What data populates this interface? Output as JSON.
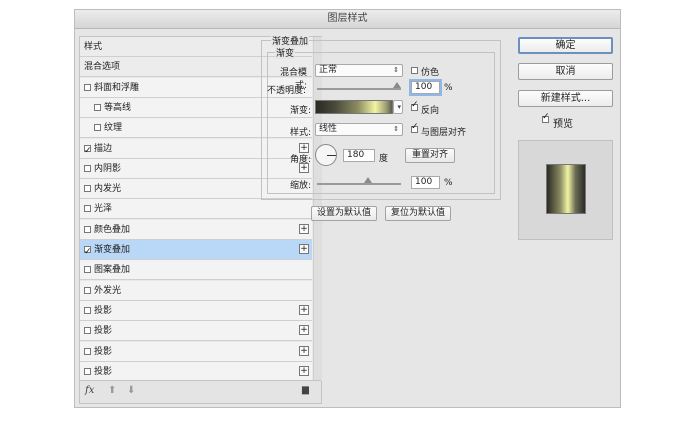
{
  "window": {
    "title": "图层样式"
  },
  "sidebar": {
    "items": [
      {
        "label": "样式",
        "checkbox": false,
        "checked": false,
        "plus": false,
        "header": true
      },
      {
        "label": "混合选项",
        "checkbox": false,
        "checked": false,
        "plus": false,
        "header": true
      },
      {
        "label": "斜面和浮雕",
        "checkbox": true,
        "checked": false,
        "plus": false
      },
      {
        "label": "等高线",
        "checkbox": true,
        "checked": false,
        "plus": false,
        "indent": true
      },
      {
        "label": "纹理",
        "checkbox": true,
        "checked": false,
        "plus": false,
        "indent": true
      },
      {
        "label": "描边",
        "checkbox": true,
        "checked": true,
        "plus": true
      },
      {
        "label": "内阴影",
        "checkbox": true,
        "checked": false,
        "plus": true
      },
      {
        "label": "内发光",
        "checkbox": true,
        "checked": false,
        "plus": false
      },
      {
        "label": "光泽",
        "checkbox": true,
        "checked": false,
        "plus": false
      },
      {
        "label": "颜色叠加",
        "checkbox": true,
        "checked": false,
        "plus": true
      },
      {
        "label": "渐变叠加",
        "checkbox": true,
        "checked": true,
        "plus": true,
        "selected": true
      },
      {
        "label": "图案叠加",
        "checkbox": true,
        "checked": false,
        "plus": false
      },
      {
        "label": "外发光",
        "checkbox": true,
        "checked": false,
        "plus": false
      },
      {
        "label": "投影",
        "checkbox": true,
        "checked": false,
        "plus": true
      },
      {
        "label": "投影",
        "checkbox": true,
        "checked": false,
        "plus": true
      },
      {
        "label": "投影",
        "checkbox": true,
        "checked": false,
        "plus": true
      },
      {
        "label": "投影",
        "checkbox": true,
        "checked": false,
        "plus": true
      }
    ],
    "bottom": {
      "fx": "fx",
      "up": "⬆",
      "down": "⬇",
      "trash": "🗑"
    }
  },
  "gradient_overlay": {
    "section_title": "渐变叠加",
    "group_title": "渐变",
    "blend_mode_label": "混合模式:",
    "blend_mode_value": "正常",
    "dither_label": "仿色",
    "dither_checked": false,
    "opacity_label": "不透明度:",
    "opacity_value": "100",
    "opacity_unit": "%",
    "gradient_label": "渐变:",
    "reverse_label": "反向",
    "reverse_checked": true,
    "style_label": "样式:",
    "style_value": "线性",
    "align_label": "与图层对齐",
    "align_checked": true,
    "angle_label": "角度:",
    "angle_value": "180",
    "angle_unit": "度",
    "reset_align_button": "重置对齐",
    "scale_label": "缩放:",
    "scale_value": "100",
    "scale_unit": "%",
    "make_default_button": "设置为默认值",
    "reset_default_button": "复位为默认值"
  },
  "actions": {
    "ok": "确定",
    "cancel": "取消",
    "new_style": "新建样式...",
    "preview_label": "预览",
    "preview_checked": true
  },
  "colors": {
    "selection": "#b9d7f6",
    "focus_ring": "#8fb8e8",
    "gradient_light": "#f2f4a3",
    "gradient_dark": "#2a2a24"
  }
}
